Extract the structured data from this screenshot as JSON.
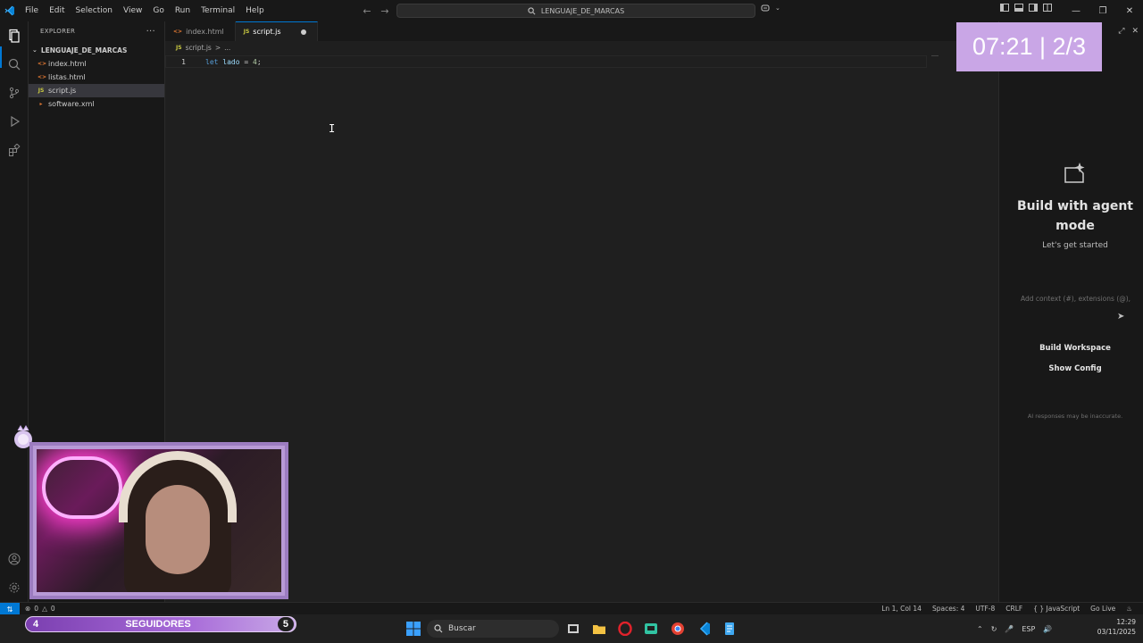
{
  "menu": [
    "File",
    "Edit",
    "Selection",
    "View",
    "Go",
    "Run",
    "Terminal",
    "Help"
  ],
  "command_center": {
    "label": "LENGUAJE_DE_MARCAS",
    "icon": "search-icon"
  },
  "explorer": {
    "title": "EXPLORER",
    "more": "···",
    "folder": "LENGUAJE_DE_MARCAS",
    "files": [
      {
        "name": "index.html",
        "icon": "html-file-icon",
        "color": "#e37933"
      },
      {
        "name": "listas.html",
        "icon": "html-file-icon",
        "color": "#e37933"
      },
      {
        "name": "script.js",
        "icon": "js-file-icon",
        "color": "#cbcb41",
        "selected": true
      },
      {
        "name": "software.xml",
        "icon": "xml-file-icon",
        "color": "#e37933"
      }
    ]
  },
  "tabs": [
    {
      "label": "index.html",
      "prefix": "<>"
    },
    {
      "label": "script.js",
      "prefix": "JS",
      "active": true,
      "dirty": true
    }
  ],
  "breadcrumb": {
    "file": "script.js",
    "sep": ">",
    "rest": "..."
  },
  "editor": {
    "line_number": "1",
    "tokens": {
      "kw": "let",
      "var": "lado",
      "op": "=",
      "num": "4",
      "end": ";"
    }
  },
  "chat": {
    "title": "Build with agent mode",
    "subtitle": "Let's get started",
    "input_placeholder": "Add context (#), extensions (@),",
    "buttons": [
      "Build Workspace",
      "Show Config"
    ],
    "disclaimer": "AI responses may be inaccurate."
  },
  "timer": {
    "text": "07:21 | 2/3"
  },
  "followers": {
    "count": "4",
    "label": "SEGUIDORES",
    "goal": "5"
  },
  "statusbar": {
    "problems": {
      "errors": "0",
      "warnings": "0"
    },
    "items": [
      "Ln 1, Col 14",
      "Spaces: 4",
      "UTF-8",
      "CRLF",
      "{ } JavaScript",
      "Go Live"
    ]
  },
  "taskbar": {
    "search_label": "Buscar",
    "lang": "ESP",
    "time": "12:29",
    "date": "03/11/2025"
  },
  "colors": {
    "accent": "#0078d4",
    "timer_bg": "#c9a6e6",
    "followers": "#a86bd9"
  }
}
